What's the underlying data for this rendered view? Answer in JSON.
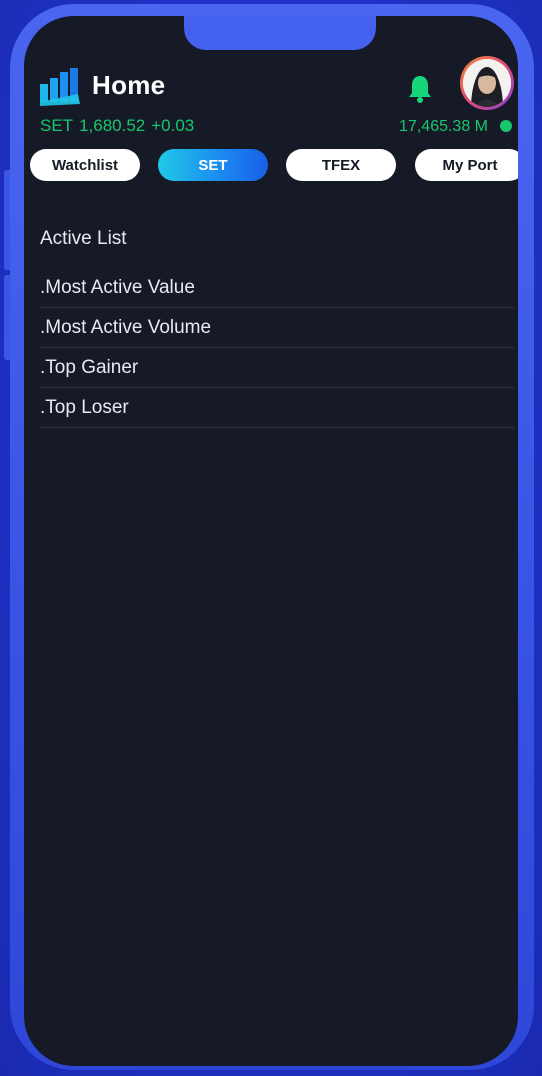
{
  "header": {
    "title": "Home",
    "notification_icon": "bell-icon",
    "avatar_icon": "user-avatar"
  },
  "index": {
    "name": "SET",
    "value": "1,680.52",
    "change": "+0.03",
    "market_value": "17,465.38 M",
    "status_color": "#17c76c"
  },
  "tabs": [
    {
      "label": "Watchlist"
    },
    {
      "label": "SET"
    },
    {
      "label": "TFEX"
    },
    {
      "label": "My Port"
    }
  ],
  "active_tab": "SET",
  "main": {
    "section_title": "Active List",
    "items": [
      {
        "label": ".Most Active Value"
      },
      {
        "label": ".Most Active Volume"
      },
      {
        "label": ".Top Gainer"
      },
      {
        "label": ".Top Loser"
      }
    ]
  },
  "colors": {
    "accent": "#17c76c",
    "background": "#151a26",
    "frame": "#3a56e6",
    "active_tab_start": "#20c9e8",
    "active_tab_end": "#1a5fe8"
  }
}
